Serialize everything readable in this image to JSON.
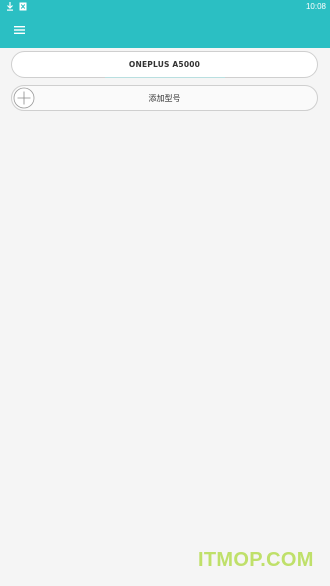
{
  "status_bar": {
    "time": "10:08",
    "icons": [
      "download-icon",
      "notification-icon"
    ]
  },
  "header": {
    "background": "#2bbfc3",
    "menu_icon": "hamburger-menu-icon"
  },
  "models": [
    {
      "label": "ONEPLUS A5000"
    }
  ],
  "add_model": {
    "label": "添加型号",
    "icon": "plus-circle-icon"
  },
  "watermark": {
    "text": "ITMOP.COM",
    "color": "#bfe06a"
  }
}
